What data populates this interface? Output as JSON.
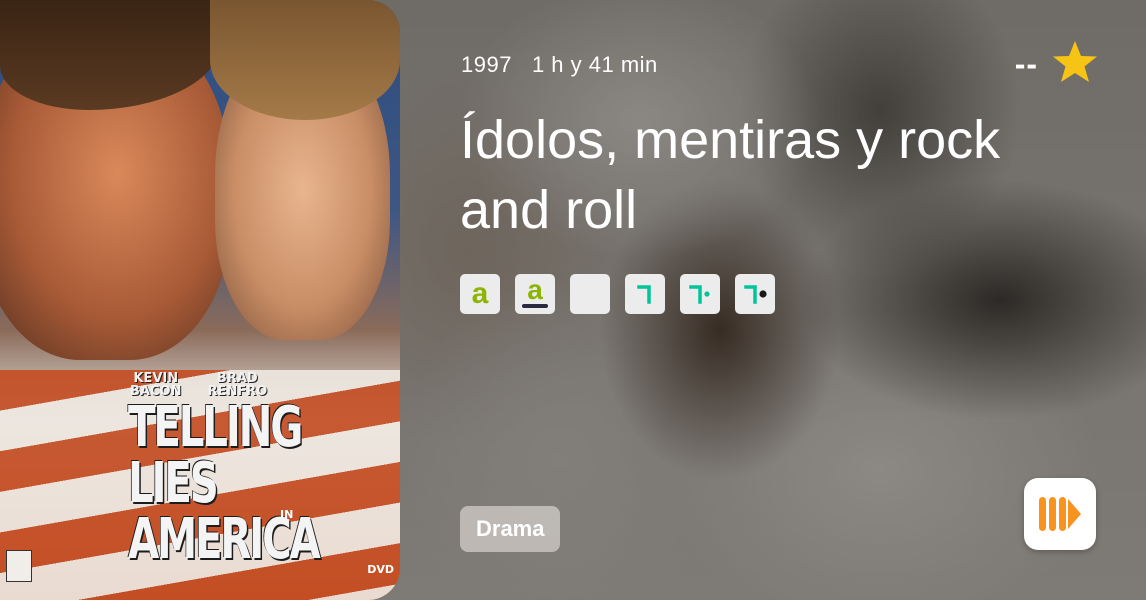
{
  "poster": {
    "credits": [
      "KEVIN\nBACON",
      "BRAD\nRENFRO"
    ],
    "title_text": "TELLING\nLIES\nAMERICA",
    "title_in": "IN",
    "dvd_label": "DVD"
  },
  "movie": {
    "year": "1997",
    "duration": "1 h y 41 min",
    "title": "Ídolos, mentiras y rock and roll",
    "rating": "--",
    "genre": "Drama"
  },
  "providers": [
    {
      "icon": "atresplayer-a-icon",
      "color": "#8cb400"
    },
    {
      "icon": "atresplayer-premium-a-icon",
      "color": "#8cb400"
    },
    {
      "icon": "blank-provider-icon",
      "color": "#ececec"
    },
    {
      "icon": "seven-icon",
      "color": "#00c49a"
    },
    {
      "icon": "seven-dot-icon",
      "color": "#00c49a"
    },
    {
      "icon": "seven-black-dot-icon",
      "color": "#00c49a"
    }
  ],
  "colors": {
    "star": "#f7c416",
    "app_orange": "#f7931e"
  }
}
